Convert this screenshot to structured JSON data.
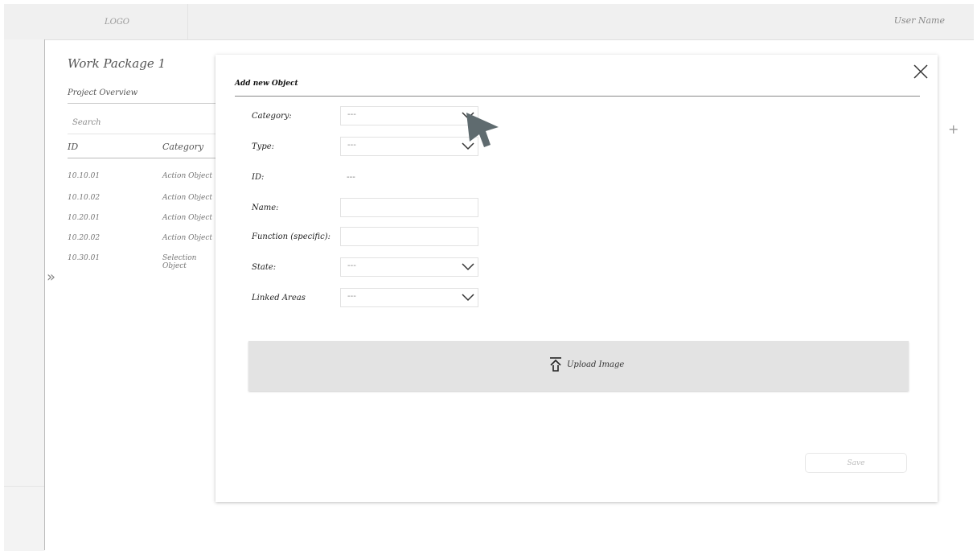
{
  "header": {
    "logo_text": "LOGO",
    "user_name": "User Name"
  },
  "sidebar": {
    "work_package_title": "Work Package 1",
    "project_overview_label": "Project Overview",
    "search_placeholder": "Search",
    "columns": {
      "id": "ID",
      "category": "Category"
    },
    "rows": [
      {
        "id": "10.10.01",
        "category": "Action Object"
      },
      {
        "id": "10.10.02",
        "category": "Action Object"
      },
      {
        "id": "10.20.01",
        "category": "Action Object"
      },
      {
        "id": "10.20.02",
        "category": "Action Object"
      },
      {
        "id": "10.30.01",
        "category": "Selection Object"
      }
    ],
    "expand_icon": "double-chevron-right-icon",
    "add_icon": "plus-icon"
  },
  "modal": {
    "title": "Add new Object",
    "close_icon": "close-icon",
    "fields": {
      "category": {
        "label": "Category:",
        "value": "---"
      },
      "type": {
        "label": "Type:",
        "value": "---"
      },
      "id": {
        "label": "ID:",
        "value": "---"
      },
      "name": {
        "label": "Name:",
        "value": ""
      },
      "function": {
        "label": "Function (specific):",
        "value": ""
      },
      "state": {
        "label": "State:",
        "value": "---"
      },
      "linked_areas": {
        "label": "Linked Areas",
        "value": "---"
      }
    },
    "upload_label": "Upload Image",
    "upload_icon": "upload-icon",
    "save_label": "Save"
  },
  "colors": {
    "modal_bg": "#ffffff",
    "upload_bar": "#e3e3e3",
    "cursor": "#5f6b6f"
  }
}
